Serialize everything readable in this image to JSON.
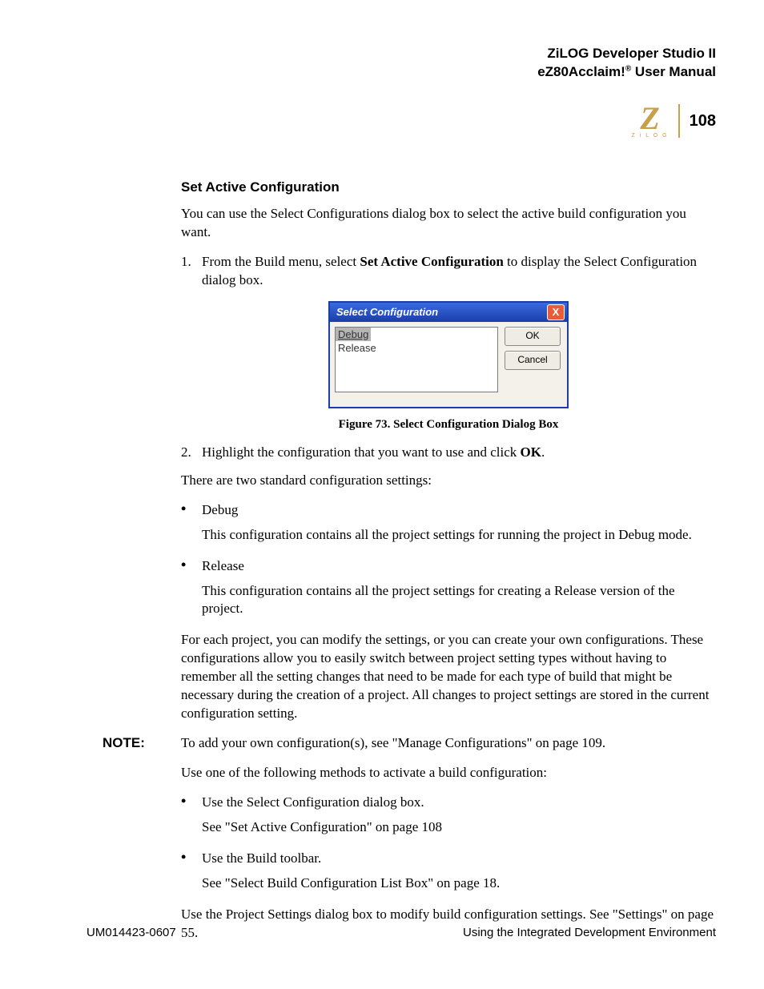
{
  "header": {
    "line1": "ZiLOG Developer Studio II",
    "line2_a": "eZ80Acclaim!",
    "line2_b": " User Manual",
    "reg": "®",
    "logo_letter": "Z",
    "logo_text": "Z i L O G",
    "page_number": "108"
  },
  "section_title": "Set Active Configuration",
  "intro": "You can use the Select Configurations dialog box to select the active build configuration you want.",
  "step1": {
    "num": "1.",
    "pre": "From the Build menu, select ",
    "bold": "Set Active Configuration",
    "post": " to display the Select Configuration dialog box."
  },
  "dialog": {
    "title": "Select Configuration",
    "close": "X",
    "options": [
      "Debug",
      "Release"
    ],
    "ok": "OK",
    "cancel": "Cancel"
  },
  "figure_caption_pre": "Figure 73. S",
  "figure_caption_bold": "elect Configuration Dialog Box",
  "step2": {
    "num": "2.",
    "pre": "Highlight the configuration that you want to use and click ",
    "bold": "OK",
    "post": "."
  },
  "two_std_intro": "There are two standard configuration settings:",
  "debug_label": "Debug",
  "debug_desc": "This configuration contains all the project settings for running the project in Debug mode.",
  "release_label": "Release",
  "release_desc": "This configuration contains all the project settings for creating a Release version of the project.",
  "modify_para": "For each project, you can modify the settings, or you can create your own configurations. These configurations allow you to easily switch between project setting types without having to remember all the setting changes that need to be made for each type of build that might be necessary during the creation of a project. All changes to project settings are stored in the current configuration setting.",
  "note_label": "NOTE:",
  "note_text": "To add your own configuration(s), see \"Manage Configurations\" on page 109.",
  "methods_intro": "Use one of the following methods to activate a build configuration:",
  "m1_label": "Use the Select Configuration dialog box.",
  "m1_see": "See \"Set Active Configuration\" on page 108",
  "m2_label": "Use the Build toolbar.",
  "m2_see": "See \"Select Build Configuration List Box\" on page 18.",
  "final_para": "Use the Project Settings dialog box to modify build configuration settings. See \"Settings\" on page 55.",
  "footer": {
    "left": "UM014423-0607",
    "right": "Using the Integrated Development Environment"
  }
}
